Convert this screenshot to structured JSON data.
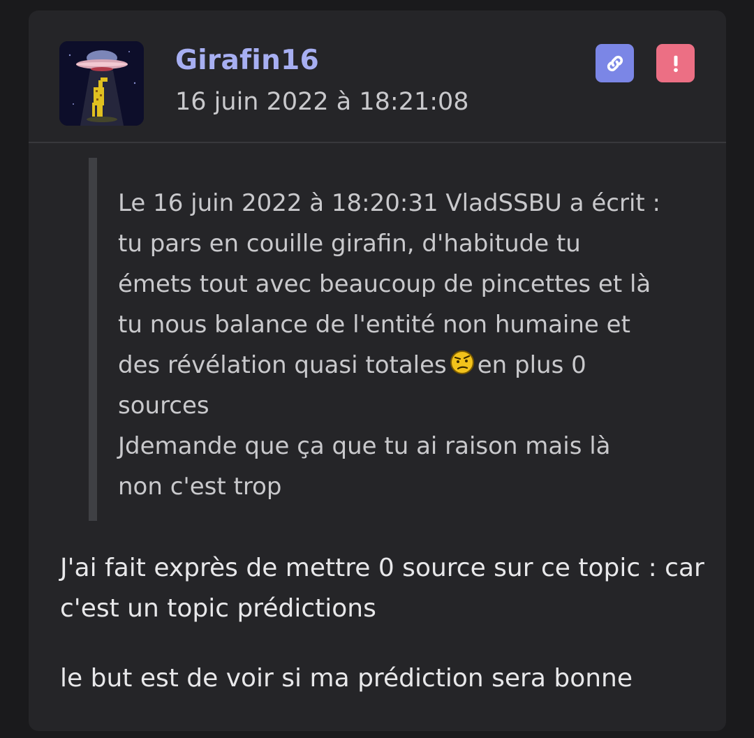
{
  "post": {
    "author": "Girafin16",
    "date": "16 juin 2022 à 18:21:08",
    "actions": {
      "link_icon": "link-icon",
      "report_icon": "exclamation-icon"
    },
    "quote": {
      "lines": [
        "Le 16 juin 2022 à 18:20:31 VladSSBU a écrit :",
        "tu pars en couille girafin, d'habitude tu",
        "émets tout avec beaucoup de pincettes et là",
        "tu nous balance de l'entité non humaine et",
        "des révélation quasi totales",
        "en plus 0",
        "sources",
        "Jdemande que ça que tu ai raison mais là",
        "non c'est trop"
      ],
      "emoji": "suspicious-face-icon"
    },
    "body": {
      "paragraph1_lines": [
        "J'ai fait exprès de mettre 0 source sur ce topic : car",
        "c'est un topic prédictions"
      ],
      "paragraph2": "le but est de voir si ma prédiction sera bonne"
    }
  },
  "colors": {
    "background": "#1a1a1c",
    "card": "#252528",
    "username": "#a7aff2",
    "link_button": "#7b86e6",
    "report_button": "#ec6f84",
    "quote_bar": "#3f4044"
  }
}
